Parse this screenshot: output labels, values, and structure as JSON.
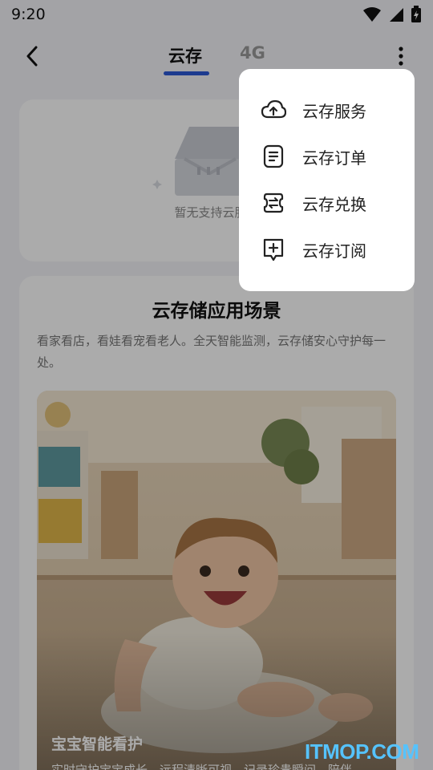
{
  "status_bar": {
    "time": "9:20"
  },
  "header": {
    "tabs": [
      {
        "label": "云存",
        "active": true
      },
      {
        "label": "4G",
        "active": false
      }
    ]
  },
  "empty_state": {
    "text": "暂无支持云服务"
  },
  "scene": {
    "title": "云存储应用场景",
    "description": "看家看店，看娃看宠看老人。全天智能监测，云存储安心守护每一处。",
    "photo": {
      "caption_title": "宝宝智能看护",
      "caption_subtitle": "实时守护宝宝成长，远程清晰可视，记录珍贵瞬间，陪伴"
    }
  },
  "menu": {
    "items": [
      {
        "label": "云存服务",
        "icon": "cloud-upload-icon"
      },
      {
        "label": "云存订单",
        "icon": "order-list-icon"
      },
      {
        "label": "云存兑换",
        "icon": "exchange-icon"
      },
      {
        "label": "云存订阅",
        "icon": "subscribe-icon"
      }
    ]
  },
  "watermark": "ITMOP.COM",
  "colors": {
    "accent": "#2c58d6",
    "watermark": "#55c3ff"
  }
}
